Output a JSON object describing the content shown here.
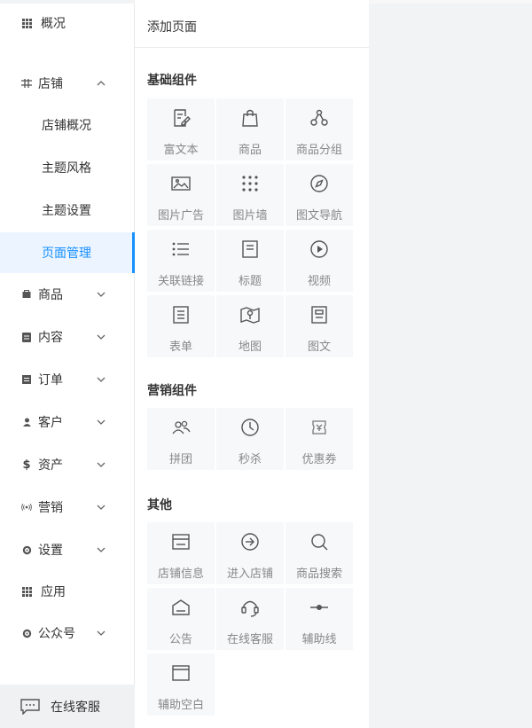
{
  "sidebar": {
    "overview": "概况",
    "store": "店铺",
    "store_sub": [
      "店铺概况",
      "主题风格",
      "主题设置",
      "页面管理"
    ],
    "goods": "商品",
    "content": "内容",
    "orders": "订单",
    "customers": "客户",
    "assets": "资产",
    "marketing": "营销",
    "settings": "设置",
    "apps": "应用",
    "official_account": "公众号",
    "service": "在线客服"
  },
  "panel": {
    "title": "添加页面",
    "basic": {
      "title": "基础组件",
      "items": [
        {
          "label": "富文本",
          "icon": "rich-text-icon"
        },
        {
          "label": "商品",
          "icon": "bag-icon"
        },
        {
          "label": "商品分组",
          "icon": "group-icon"
        },
        {
          "label": "图片广告",
          "icon": "image-icon"
        },
        {
          "label": "图片墙",
          "icon": "grid-dots-icon"
        },
        {
          "label": "图文导航",
          "icon": "compass-icon"
        },
        {
          "label": "关联链接",
          "icon": "list-icon"
        },
        {
          "label": "标题",
          "icon": "title-icon"
        },
        {
          "label": "视频",
          "icon": "play-icon"
        },
        {
          "label": "表单",
          "icon": "form-icon"
        },
        {
          "label": "地图",
          "icon": "map-icon"
        },
        {
          "label": "图文",
          "icon": "article-icon"
        }
      ]
    },
    "marketing": {
      "title": "营销组件",
      "items": [
        {
          "label": "拼团",
          "icon": "group-buy-icon"
        },
        {
          "label": "秒杀",
          "icon": "clock-icon"
        },
        {
          "label": "优惠券",
          "icon": "coupon-icon"
        }
      ]
    },
    "other": {
      "title": "其他",
      "items": [
        {
          "label": "店铺信息",
          "icon": "storefront-icon"
        },
        {
          "label": "进入店铺",
          "icon": "enter-icon"
        },
        {
          "label": "商品搜索",
          "icon": "search-icon"
        },
        {
          "label": "公告",
          "icon": "notice-icon"
        },
        {
          "label": "在线客服",
          "icon": "headset-icon"
        },
        {
          "label": "辅助线",
          "icon": "divider-icon"
        },
        {
          "label": "辅助空白",
          "icon": "blank-icon"
        }
      ]
    }
  },
  "colors": {
    "accent": "#1890ff",
    "active_bg": "#ecf5ff",
    "tile_bg": "#f7f8fa"
  }
}
